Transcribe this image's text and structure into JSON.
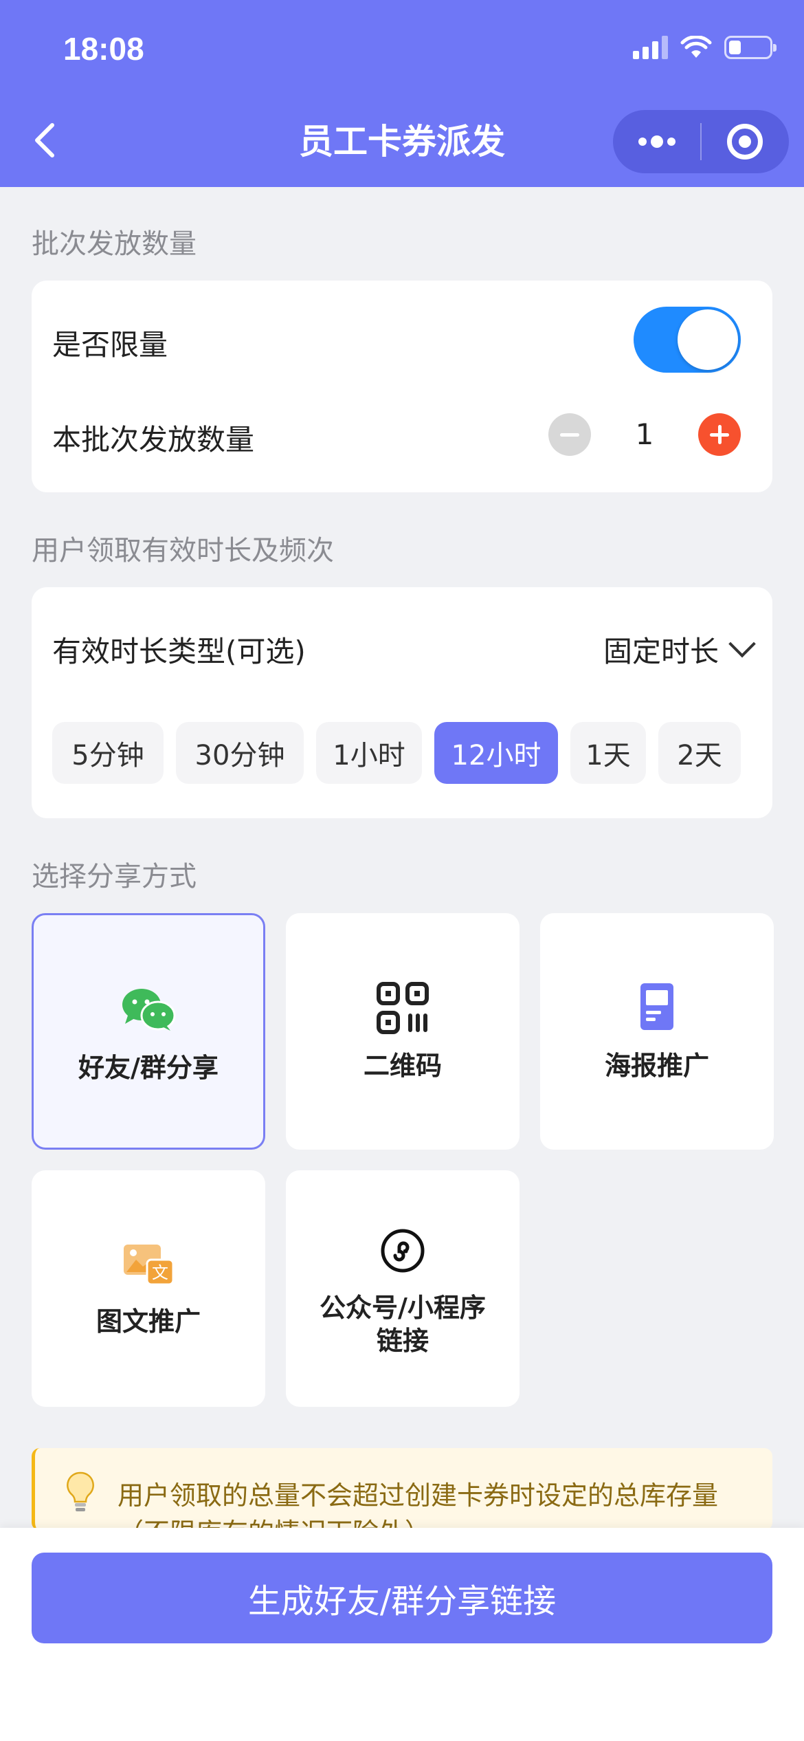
{
  "status_bar": {
    "time": "18:08"
  },
  "nav": {
    "title": "员工卡券派发"
  },
  "batch": {
    "section_title": "批次发放数量",
    "limit_label": "是否限量",
    "limit_enabled": true,
    "quantity_label": "本批次发放数量",
    "quantity_value": "1"
  },
  "validity": {
    "section_title": "用户领取有效时长及频次",
    "type_label": "有效时长类型(可选)",
    "type_value": "固定时长",
    "durations": [
      "5分钟",
      "30分钟",
      "1小时",
      "12小时",
      "1天",
      "2天"
    ],
    "selected_duration": "12小时"
  },
  "share": {
    "section_title": "选择分享方式",
    "options": [
      {
        "label": "好友/群分享",
        "icon": "wechat-icon",
        "selected": true
      },
      {
        "label": "二维码",
        "icon": "qrcode-icon",
        "selected": false
      },
      {
        "label": "海报推广",
        "icon": "poster-icon",
        "selected": false
      },
      {
        "label": "图文推广",
        "icon": "image-text-icon",
        "selected": false
      },
      {
        "label": "公众号/小程序链接",
        "icon": "miniprogram-icon",
        "selected": false
      }
    ]
  },
  "tip": {
    "text": "用户领取的总量不会超过创建卡券时设定的总库存量（不限库存的情况下除外）"
  },
  "primary_button": {
    "label": "生成好友/群分享链接"
  },
  "colors": {
    "accent": "#6f77f6",
    "toggle_on": "#1f8bff",
    "plus": "#f7512e",
    "wechat": "#3fba5a",
    "poster": "#6f77f6",
    "image_text": "#f2a33a"
  }
}
